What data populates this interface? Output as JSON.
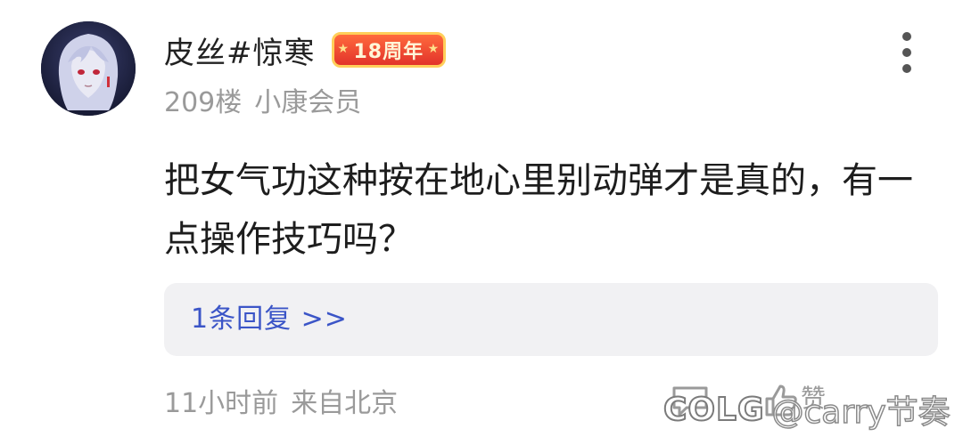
{
  "user": {
    "name": "皮丝#惊寒",
    "badge": "18周年"
  },
  "meta": {
    "floor": "209楼",
    "member": "小康会员"
  },
  "post": {
    "content": "把女气功这种按在地心里别动弹才是真的，有一点操作技巧吗？"
  },
  "replies": {
    "link_label": "1条回复 >>"
  },
  "footer": {
    "time": "11小时前",
    "location": "来自北京",
    "like_label": "赞"
  },
  "watermark": {
    "logo": "COLG",
    "handle": "@carry节奏"
  },
  "colors": {
    "link": "#3b55c7",
    "badge_bg": "#e2332a",
    "badge_border": "#ffcf5a",
    "muted": "#9a9a9a",
    "reply_bg": "#f1f1f3"
  },
  "icons": {
    "more": "more-vertical-icon",
    "reply": "comment-icon",
    "like": "thumbs-up-icon"
  }
}
